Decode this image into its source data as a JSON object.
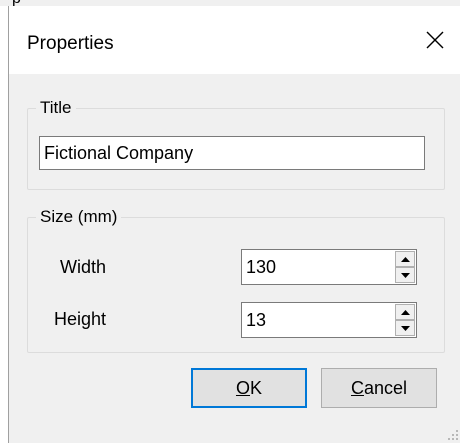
{
  "background_fragment": "p",
  "dialog": {
    "title": "Properties",
    "close_glyph": "✕"
  },
  "title_group": {
    "legend": "Title",
    "value": "Fictional Company"
  },
  "size_group": {
    "legend": "Size (mm)",
    "width_label": "Width",
    "width_value": "130",
    "height_label": "Height",
    "height_value": "13"
  },
  "buttons": {
    "ok_mnemonic": "O",
    "ok_rest": "K",
    "cancel_mnemonic": "C",
    "cancel_rest": "ancel"
  },
  "colors": {
    "dialog_bg": "#f0f0f0",
    "default_button_border": "#0078d7"
  }
}
